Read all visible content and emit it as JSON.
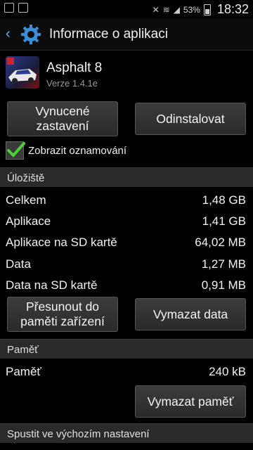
{
  "status_bar": {
    "battery": "53%",
    "time": "18:32"
  },
  "action_bar": {
    "title": "Informace o aplikaci"
  },
  "app": {
    "name": "Asphalt 8",
    "version": "Verze 1.4.1e"
  },
  "buttons": {
    "force_stop": "Vynucené zastavení",
    "uninstall": "Odinstalovat",
    "move": "Přesunout do paměti zařízení",
    "clear_data": "Vymazat data",
    "clear_memory": "Vymazat paměť"
  },
  "notifications_checkbox": {
    "label": "Zobrazit oznamování",
    "checked": true
  },
  "storage": {
    "header": "Úložiště",
    "rows": [
      {
        "label": "Celkem",
        "value": "1,48 GB"
      },
      {
        "label": "Aplikace",
        "value": "1,41 GB"
      },
      {
        "label": "Aplikace na SD kartě",
        "value": "64,02 MB"
      },
      {
        "label": "Data",
        "value": "1,27 MB"
      },
      {
        "label": "Data na SD kartě",
        "value": "0,91 MB"
      }
    ]
  },
  "memory": {
    "header": "Paměť",
    "rows": [
      {
        "label": "Paměť",
        "value": "240 kB"
      }
    ]
  },
  "launch_default": {
    "header": "Spustit ve výchozím nastavení"
  },
  "colors": {
    "accent": "#5fb3e8",
    "check": "#4cd137",
    "section_bg": "#2a2a2a"
  }
}
